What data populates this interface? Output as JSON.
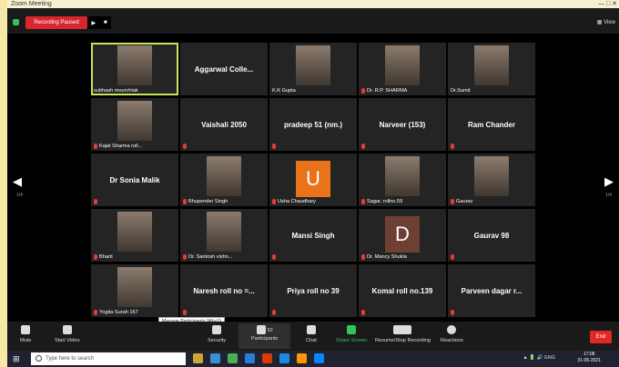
{
  "window": {
    "title": "Zoom Meeting",
    "controls": "—  □  ✕"
  },
  "topbar": {
    "recording_label": "Recording Paused",
    "play_symbol": "▶",
    "stop_symbol": "■",
    "view_label": "View",
    "colors": {
      "recording": "#d9262e",
      "shield": "#35c45a"
    }
  },
  "navigation": {
    "left_arrow": "◀",
    "right_arrow": "▶",
    "left_page": "1/4",
    "right_page": "1/4"
  },
  "tiles": [
    {
      "name": "",
      "label": "subhash mourchtak",
      "kind": "photo",
      "mic": false
    },
    {
      "name": "Aggarwal Colle...",
      "label": "",
      "kind": "name",
      "mic": false
    },
    {
      "name": "",
      "label": "K.K Gupta",
      "kind": "photo",
      "mic": false
    },
    {
      "name": "",
      "label": "Dr. R.P. SHARMA",
      "kind": "photo",
      "mic": true
    },
    {
      "name": "",
      "label": "Dr.Sumit",
      "kind": "photo",
      "mic": false
    },
    {
      "name": "",
      "label": "Kajal Sharma roll...",
      "kind": "photo",
      "mic": true
    },
    {
      "name": "Vaishali 2050",
      "label": "",
      "kind": "name",
      "mic": true
    },
    {
      "name": "pradeep 51 (nm.)",
      "label": "",
      "kind": "name",
      "mic": true
    },
    {
      "name": "Narveer (153)",
      "label": "",
      "kind": "name",
      "mic": true
    },
    {
      "name": "Ram Chander",
      "label": "",
      "kind": "name",
      "mic": true
    },
    {
      "name": "Dr Sonia Malik",
      "label": "",
      "kind": "name",
      "mic": true
    },
    {
      "name": "",
      "label": "Bhupender Singh",
      "kind": "photo",
      "mic": true
    },
    {
      "name": "",
      "label": "Usha Chaudhary",
      "kind": "letter",
      "letter": "U",
      "color": "#e8731a",
      "mic": true
    },
    {
      "name": "",
      "label": "Sagar, rollno.59",
      "kind": "photo",
      "mic": true
    },
    {
      "name": "",
      "label": "Gaurav",
      "kind": "photo",
      "mic": true
    },
    {
      "name": "",
      "label": "Bharti",
      "kind": "photo",
      "mic": true
    },
    {
      "name": "",
      "label": "Dr. Santosh vishn...",
      "kind": "photo",
      "mic": true
    },
    {
      "name": "Mansi Singh",
      "label": "",
      "kind": "name",
      "mic": true
    },
    {
      "name": "",
      "label": "Dr. Mancy Shukla",
      "kind": "letter",
      "letter": "D",
      "color": "#6e4034",
      "mic": true
    },
    {
      "name": "Gaurav 98",
      "label": "",
      "kind": "name",
      "mic": true
    },
    {
      "name": "",
      "label": "Yogita Surah 167",
      "kind": "photo",
      "mic": true
    },
    {
      "name": "Naresh roll no =...",
      "label": "",
      "kind": "name",
      "mic": true
    },
    {
      "name": "Priya roll no 39",
      "label": "",
      "kind": "name",
      "mic": true
    },
    {
      "name": "Komal roll no.139",
      "label": "",
      "kind": "name",
      "mic": true
    },
    {
      "name": "Parveen dagar r...",
      "label": "",
      "kind": "name",
      "mic": true
    }
  ],
  "toolbar": {
    "mute": "Mute",
    "start_video": "Start Video",
    "security": "Security",
    "participants": "Participants",
    "participants_count": "92",
    "chat": "Chat",
    "share_screen": "Share Screen",
    "resume_recording": "Resume/Stop Recording",
    "reactions": "Reactions",
    "end": "End",
    "tooltip": "Manage Participants (Alt+U)",
    "colors": {
      "share": "#35c45a",
      "end": "#e02828"
    }
  },
  "taskbar": {
    "search_placeholder": "Type here to search",
    "tray_lang": "ENG",
    "time": "17:08",
    "date": "31-05-2021",
    "app_colors": [
      "#cfa338",
      "#3b8ed8",
      "#4caf50",
      "#2b7cd3",
      "#d83b01",
      "#1e88e5",
      "#ff9800",
      "#0a84ff"
    ]
  }
}
